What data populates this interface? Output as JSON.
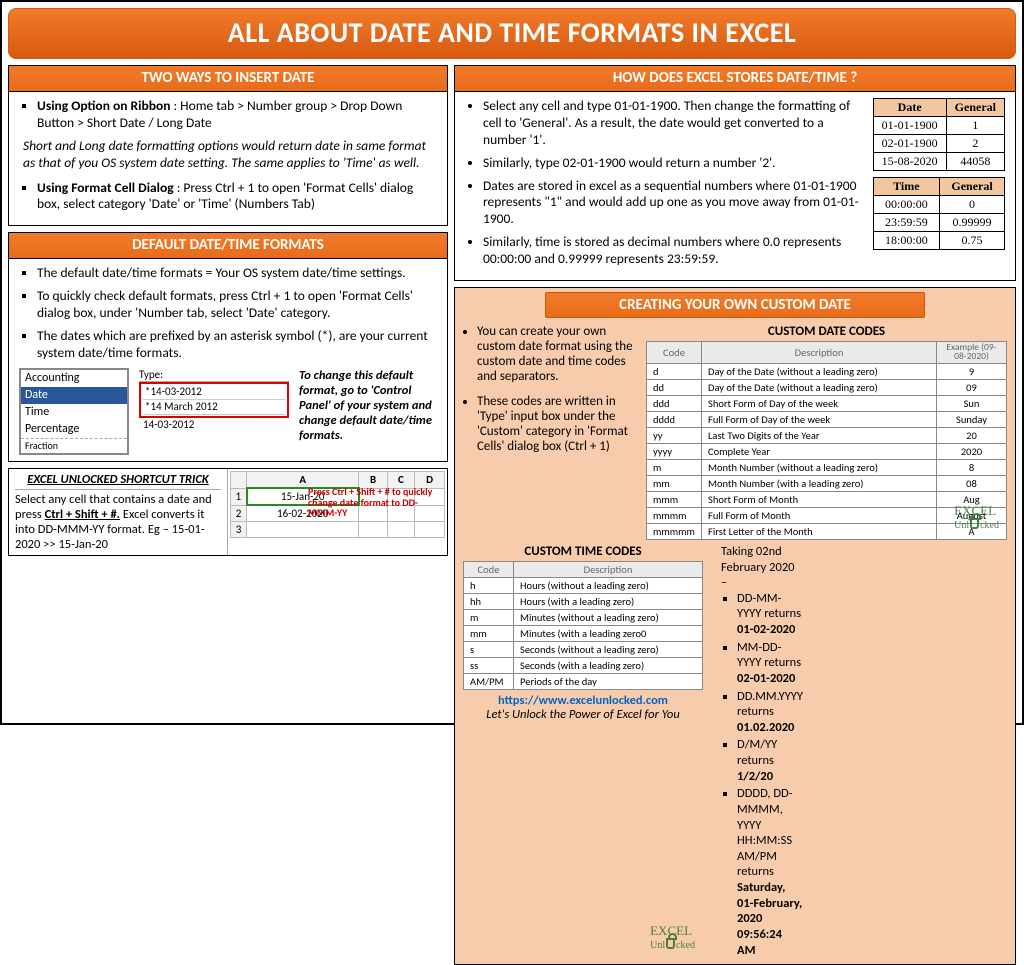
{
  "title": "ALL ABOUT DATE AND TIME FORMATS IN EXCEL",
  "two_ways": {
    "heading": "TWO WAYS TO INSERT DATE",
    "opt1_label": "Using Option on Ribbon",
    "opt1_text": " : Home tab > Number group > Drop Down Button > Short Date / Long Date",
    "note": "Short and Long date formatting options would return date in same format as that of you OS system date setting. The same applies to 'Time' as well.",
    "opt2_label": "Using Format Cell Dialog",
    "opt2_text": " : Press Ctrl + 1 to open 'Format Cells' dialog box, select category 'Date' or 'Time' (Numbers Tab)"
  },
  "stores": {
    "heading": "HOW DOES EXCEL STORES DATE/TIME ?",
    "b1": "Select any cell and type 01-01-1900. Then change the formatting of cell to 'General'. As a result, the date would get converted to a number '1'.",
    "b2": "Similarly, type 02-01-1900 would return a number '2'.",
    "b3": "Dates are stored in excel as a sequential numbers where 01-01-1900 represents \"1\" and would add up one as you move away from 01-01-1900.",
    "b4": "Similarly, time is stored as decimal numbers where 0.0 represents 00:00:00 and 0.99999 represents 23:59:59.",
    "date_table": {
      "h1": "Date",
      "h2": "General",
      "rows": [
        [
          "01-01-1900",
          "1"
        ],
        [
          "02-01-1900",
          "2"
        ],
        [
          "15-08-2020",
          "44058"
        ]
      ]
    },
    "time_table": {
      "h1": "Time",
      "h2": "General",
      "rows": [
        [
          "00:00:00",
          "0"
        ],
        [
          "23:59:59",
          "0.99999"
        ],
        [
          "18:00:00",
          "0.75"
        ]
      ]
    }
  },
  "defaults": {
    "heading": "DEFAULT DATE/TIME FORMATS",
    "b1": "The default date/time formats = Your OS system date/time settings.",
    "b2": "To quickly check default formats, press Ctrl + 1 to open 'Format Cells' dialog box, under 'Number tab, select 'Date' category.",
    "b3": "The dates which are prefixed by an asterisk symbol (*), are your current system date/time formats.",
    "mock_cats": [
      "Accounting",
      "Date",
      "Time",
      "Percentage",
      "Fraction"
    ],
    "mock_type_label": "Type:",
    "mock_types": [
      "*14-03-2012",
      "*14 March 2012",
      "14-03-2012"
    ],
    "change_note": "To change this default format, go to 'Control Panel' of your system and change default date/time formats."
  },
  "trick": {
    "title": "EXCEL UNLOCKED SHORTCUT TRICK",
    "text_a": "Select any cell that contains a date and press ",
    "text_key": "Ctrl + Shift + #.",
    "text_b": " Excel converts it into DD-MMM-YY format. Eg – 15-01-2020 >> 15-Jan-20",
    "sheet_cols": [
      "",
      "A",
      "B",
      "C",
      "D"
    ],
    "sheet_rows": [
      [
        "1",
        "15-Jan-20",
        "",
        "",
        ""
      ],
      [
        "2",
        "16-02-2020",
        "",
        "",
        ""
      ],
      [
        "3",
        "",
        "",
        "",
        ""
      ]
    ],
    "callout": "Press Ctrl + Shift + # to quickly change date format to DD-MMM-YY"
  },
  "custom": {
    "heading": "CREATING YOUR OWN CUSTOM DATE",
    "intro1": "You can create your own custom date format using the custom date and time codes and separators.",
    "intro2": "These codes are written in 'Type' input box under the 'Custom' category in 'Format Cells' dialog box (Ctrl + 1)",
    "date_codes_title": "CUSTOM DATE CODES",
    "date_codes_headers": [
      "Code",
      "Description",
      "Example (09-08-2020)"
    ],
    "date_codes": [
      [
        "d",
        "Day of the Date (without a leading zero)",
        "9"
      ],
      [
        "dd",
        "Day of the Date (without a leading zero)",
        "09"
      ],
      [
        "ddd",
        "Short Form of Day of the week",
        "Sun"
      ],
      [
        "dddd",
        "Full Form of Day of the week",
        "Sunday"
      ],
      [
        "yy",
        "Last Two Digits of the Year",
        "20"
      ],
      [
        "yyyy",
        "Complete Year",
        "2020"
      ],
      [
        "m",
        "Month Number (without a leading zero)",
        "8"
      ],
      [
        "mm",
        "Month Number (with a leading zero)",
        "08"
      ],
      [
        "mmm",
        "Short Form of Month",
        "Aug"
      ],
      [
        "mmmm",
        "Full Form of Month",
        "August"
      ],
      [
        "mmmmm",
        "First Letter of the Month",
        "A"
      ]
    ],
    "time_codes_title": "CUSTOM TIME CODES",
    "time_codes_headers": [
      "Code",
      "Description"
    ],
    "time_codes": [
      [
        "h",
        "Hours (without a leading zero)"
      ],
      [
        "hh",
        "Hours (with a leading zero)"
      ],
      [
        "m",
        "Minutes (without a leading zero)"
      ],
      [
        "mm",
        "Minutes (with a leading zero0"
      ],
      [
        "s",
        "Seconds (without a leading zero)"
      ],
      [
        "ss",
        "Seconds (with a leading zero)"
      ],
      [
        "AM/PM",
        "Periods of the day"
      ]
    ],
    "examples_lead": "Taking 02nd February 2020 –",
    "ex1a": "DD-MM-YYYY returns ",
    "ex1b": "01-02-2020",
    "ex2a": "MM-DD-YYYY returns ",
    "ex2b": "02-01-2020",
    "ex3a": "DD.MM.YYYY returns ",
    "ex3b": "01.02.2020",
    "ex4a": "D/M/YY returns ",
    "ex4b": "1/2/20",
    "ex5a": "DDDD, DD-MMMM, YYYY HH:MM:SS AM/PM returns ",
    "ex5b": "Saturday, 01-February, 2020 09:56:24 AM",
    "link_text": "https://www.excelunlocked.com",
    "tagline": "Let's Unlock the Power of Excel for You",
    "watermark_a": "EXCE",
    "watermark_b": "L",
    "watermark_c": "Unl",
    "watermark_d": "cked"
  }
}
